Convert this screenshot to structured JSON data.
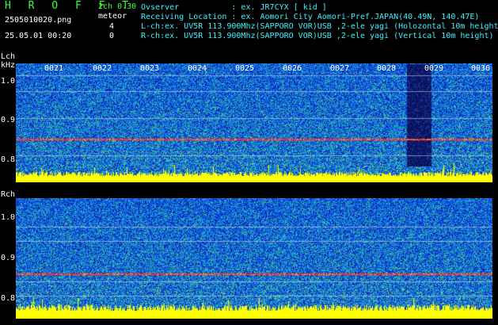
{
  "header": {
    "brand": "H R O F F T",
    "filename": "2505010020.png",
    "timestamp": "25.05.01 00:20",
    "channel_info": "2ch 0.30",
    "detection_label": "meteor",
    "lch_count": "4",
    "rch_count": "0",
    "observer_line": "Ovserver           : ex. JR7CYX [ kid ]",
    "location_line": "Receiving Location : ex. Aomori City Aomori-Pref.JAPAN(40.49N, 140.47E)",
    "lch_line": "L-ch:ex. UV5R 113.900Mhz(SAPPORO VOR)USB ,2-ele yagi (Holozontal 10m height)",
    "rch_line": "R-ch:ex. UV5R 113.900Mhz(SAPPORO VOR)USB ,2-ele yagi (Vertical 10m height)"
  },
  "lch_panel": {
    "label": "Lch",
    "unit": "kHz",
    "y_ticks": [
      "1.0",
      "0.9",
      "0.8"
    ],
    "x_ticks": [
      "0021",
      "0022",
      "0023",
      "0024",
      "0025",
      "0026",
      "0027",
      "0028",
      "0029",
      "0030"
    ]
  },
  "rch_panel": {
    "label": "Rch",
    "y_ticks": [
      "1.0",
      "0.9",
      "0.8"
    ]
  },
  "colors": {
    "background": "#000000",
    "noise_low": "#0a2ad0",
    "noise_mid": "#12a8e0",
    "noise_high": "#4cc86a",
    "baseline": "#ffff00",
    "carrier": "#ff2a2a",
    "meteor_burst": "#0b1a6a"
  },
  "signal": {
    "meteor_event_minute": "0029"
  }
}
